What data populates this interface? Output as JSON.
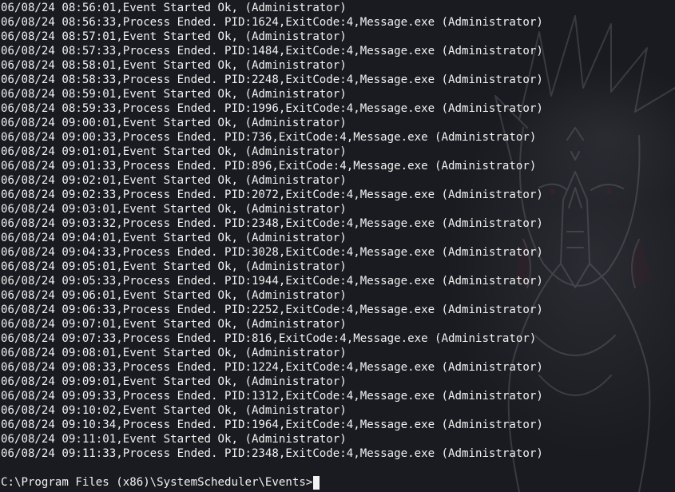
{
  "terminal": {
    "log_lines": [
      "06/08/24 08:56:01,Event Started Ok, (Administrator)",
      "06/08/24 08:56:33,Process Ended. PID:1624,ExitCode:4,Message.exe (Administrator)",
      "06/08/24 08:57:01,Event Started Ok, (Administrator)",
      "06/08/24 08:57:33,Process Ended. PID:1484,ExitCode:4,Message.exe (Administrator)",
      "06/08/24 08:58:01,Event Started Ok, (Administrator)",
      "06/08/24 08:58:33,Process Ended. PID:2248,ExitCode:4,Message.exe (Administrator)",
      "06/08/24 08:59:01,Event Started Ok, (Administrator)",
      "06/08/24 08:59:33,Process Ended. PID:1996,ExitCode:4,Message.exe (Administrator)",
      "06/08/24 09:00:01,Event Started Ok, (Administrator)",
      "06/08/24 09:00:33,Process Ended. PID:736,ExitCode:4,Message.exe (Administrator)",
      "06/08/24 09:01:01,Event Started Ok, (Administrator)",
      "06/08/24 09:01:33,Process Ended. PID:896,ExitCode:4,Message.exe (Administrator)",
      "06/08/24 09:02:01,Event Started Ok, (Administrator)",
      "06/08/24 09:02:33,Process Ended. PID:2072,ExitCode:4,Message.exe (Administrator)",
      "06/08/24 09:03:01,Event Started Ok, (Administrator)",
      "06/08/24 09:03:32,Process Ended. PID:2348,ExitCode:4,Message.exe (Administrator)",
      "06/08/24 09:04:01,Event Started Ok, (Administrator)",
      "06/08/24 09:04:33,Process Ended. PID:3028,ExitCode:4,Message.exe (Administrator)",
      "06/08/24 09:05:01,Event Started Ok, (Administrator)",
      "06/08/24 09:05:33,Process Ended. PID:1944,ExitCode:4,Message.exe (Administrator)",
      "06/08/24 09:06:01,Event Started Ok, (Administrator)",
      "06/08/24 09:06:33,Process Ended. PID:2252,ExitCode:4,Message.exe (Administrator)",
      "06/08/24 09:07:01,Event Started Ok, (Administrator)",
      "06/08/24 09:07:33,Process Ended. PID:816,ExitCode:4,Message.exe (Administrator)",
      "06/08/24 09:08:01,Event Started Ok, (Administrator)",
      "06/08/24 09:08:33,Process Ended. PID:1224,ExitCode:4,Message.exe (Administrator)",
      "06/08/24 09:09:01,Event Started Ok, (Administrator)",
      "06/08/24 09:09:33,Process Ended. PID:1312,ExitCode:4,Message.exe (Administrator)",
      "06/08/24 09:10:02,Event Started Ok, (Administrator)",
      "06/08/24 09:10:34,Process Ended. PID:1964,ExitCode:4,Message.exe (Administrator)",
      "06/08/24 09:11:01,Event Started Ok, (Administrator)",
      "06/08/24 09:11:33,Process Ended. PID:2348,ExitCode:4,Message.exe (Administrator)"
    ],
    "prompt": "C:\\Program Files (x86)\\SystemScheduler\\Events>",
    "command_input": "",
    "colors": {
      "background": "#1a1b21",
      "foreground": "#f2f2f2",
      "cursor": "#f2f2f2"
    },
    "wallpaper": "anime-character-praying-hands-artwork"
  }
}
